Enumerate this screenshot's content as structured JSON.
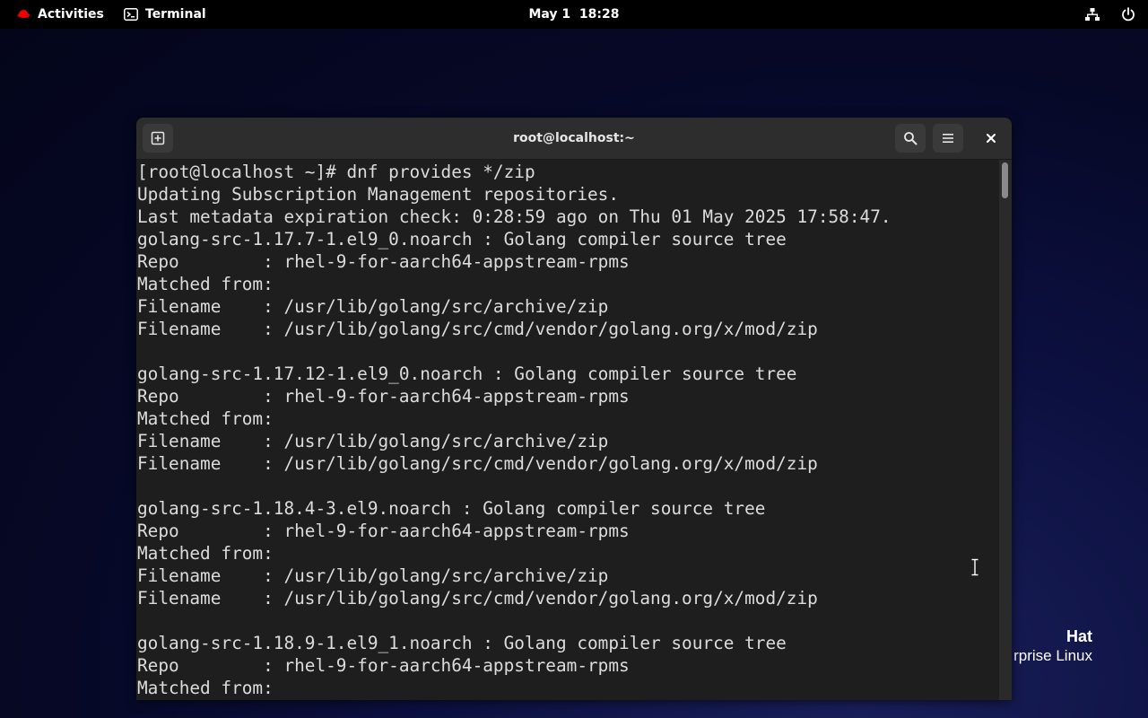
{
  "topbar": {
    "activities_label": "Activities",
    "app_label": "Terminal",
    "clock": "May 1  18:28",
    "icons": [
      "redhat-logo-icon",
      "terminal-icon",
      "network-icon",
      "power-icon"
    ]
  },
  "desktop": {
    "brand_line1": "Hat",
    "brand_line2": "rprise Linux"
  },
  "window": {
    "title": "root@localhost:~",
    "buttons": [
      "new-tab-button",
      "search-button",
      "menu-button",
      "close-button"
    ]
  },
  "terminal": {
    "lines": [
      "[root@localhost ~]# dnf provides */zip",
      "Updating Subscription Management repositories.",
      "Last metadata expiration check: 0:28:59 ago on Thu 01 May 2025 17:58:47.",
      "golang-src-1.17.7-1.el9_0.noarch : Golang compiler source tree",
      "Repo        : rhel-9-for-aarch64-appstream-rpms",
      "Matched from:",
      "Filename    : /usr/lib/golang/src/archive/zip",
      "Filename    : /usr/lib/golang/src/cmd/vendor/golang.org/x/mod/zip",
      "",
      "golang-src-1.17.12-1.el9_0.noarch : Golang compiler source tree",
      "Repo        : rhel-9-for-aarch64-appstream-rpms",
      "Matched from:",
      "Filename    : /usr/lib/golang/src/archive/zip",
      "Filename    : /usr/lib/golang/src/cmd/vendor/golang.org/x/mod/zip",
      "",
      "golang-src-1.18.4-3.el9.noarch : Golang compiler source tree",
      "Repo        : rhel-9-for-aarch64-appstream-rpms",
      "Matched from:",
      "Filename    : /usr/lib/golang/src/archive/zip",
      "Filename    : /usr/lib/golang/src/cmd/vendor/golang.org/x/mod/zip",
      "",
      "golang-src-1.18.9-1.el9_1.noarch : Golang compiler source tree",
      "Repo        : rhel-9-for-aarch64-appstream-rpms",
      "Matched from:"
    ]
  },
  "colors": {
    "terminal_bg": "#1e1e1e",
    "terminal_fg": "#dcdcdc",
    "titlebar_bg": "#2d2d2d",
    "topbar_bg": "#000000",
    "redhat_red": "#ee0000"
  }
}
